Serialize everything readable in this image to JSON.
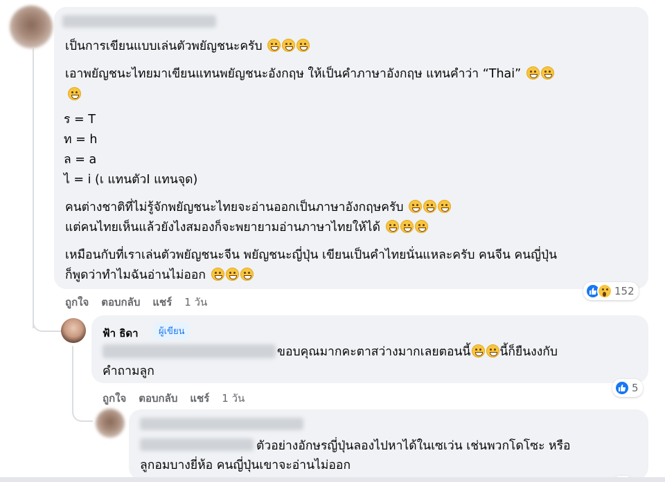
{
  "comment1": {
    "lines": [
      "เป็นการเขียนแบบเล่นตัวพยัญชนะครับ",
      "เอาพยัญชนะไทยมาเขียนแทนพยัญชนะอังกฤษ ให้เป็นคำภาษาอังกฤษ แทนคำว่า “Thai”",
      "ร = T",
      "ท = h",
      "ล = a",
      "ไ = i (เ แทนตัวI แทนจุด)",
      "คนต่างชาติที่ไม่รู้จักพยัญชนะไทยจะอ่านออกเป็นภาษาอังกฤษครับ",
      "แต่คนไทยเห็นแล้วยังไงสมองก็จะพยายามอ่านภาษาไทยให้ได้",
      "เหมือนกับที่เราเล่นตัวพยัญชนะจีน พยัญชนะญี่ปุ่น เขียนเป็นคำไทยนั่นแหละครับ คนจีน คนญี่ปุ่น",
      "ก็พูดว่าทำไมฉันอ่านไม่ออก"
    ],
    "actions": {
      "like": "ถูกใจ",
      "reply": "ตอบกลับ",
      "share": "แชร์",
      "time": "1 วัน"
    },
    "reaction_count": "152",
    "reaction_icons": [
      "like-icon",
      "wow-icon"
    ]
  },
  "reply1": {
    "author": "ฟ้า ธิดา",
    "badge": "ผู้เขียน",
    "line1": "ขอบคุณมากคะตาสว่างมากเลยตอนนี้",
    "line1_after": "นี้ก็ยืนงงกับ",
    "line2": "คำถามลูก",
    "actions": {
      "like": "ถูกใจ",
      "reply": "ตอบกลับ",
      "share": "แชร์",
      "time": "1 วัน"
    },
    "reaction_count": "5",
    "reaction_icons": [
      "like-icon"
    ]
  },
  "reply2": {
    "line1": "ตัวอย่างอักษรญี่ปุ่นลองไปหาได้ในเซเว่น เช่นพวกโดโซะ หรือ",
    "line2": "ลูกอมบางยี่ห้อ คนญี่ปุ่นเขาจะอ่านไม่ออก"
  },
  "colors": {
    "bubble": "#f0f2f5",
    "link_blue": "#1877f2",
    "meta_gray": "#65676b"
  }
}
